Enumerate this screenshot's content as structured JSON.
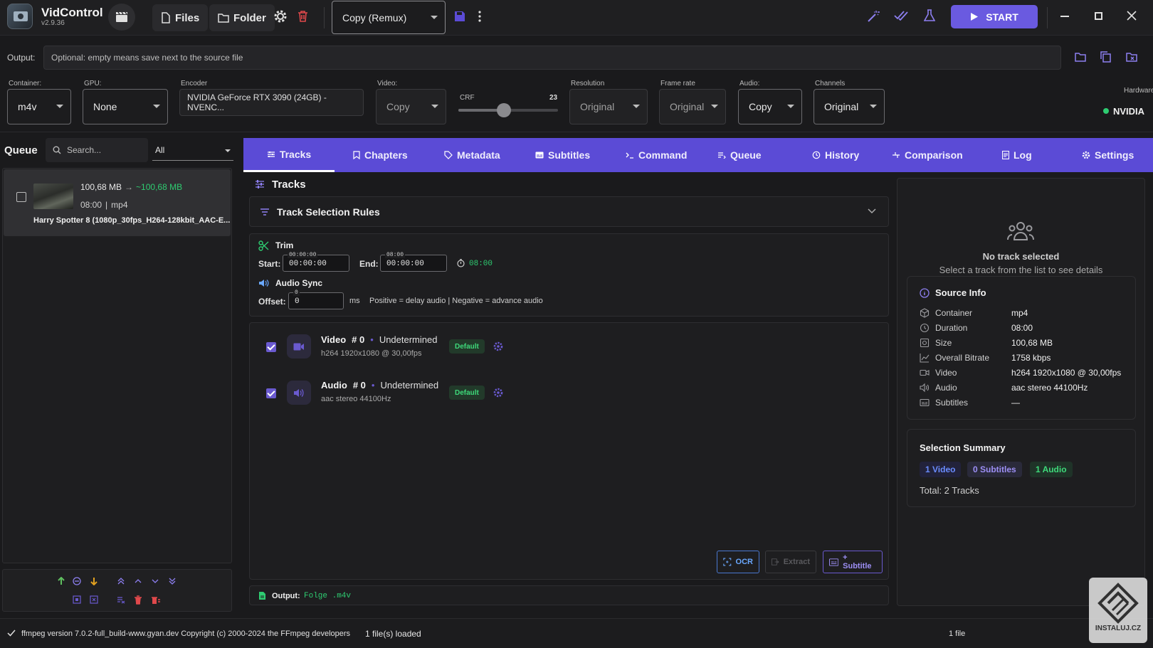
{
  "app": {
    "name": "VidControl",
    "version": "v2.9.36"
  },
  "toolbar": {
    "files_label": "Files",
    "folder_label": "Folder",
    "preset_value": "Copy (Remux)",
    "start_label": "START"
  },
  "output": {
    "label": "Output:",
    "placeholder": "Optional: empty means save next to the source file"
  },
  "settings": {
    "container_label": "Container:",
    "container_value": "m4v",
    "gpu_label": "GPU:",
    "gpu_value": "None",
    "encoder_label": "Encoder",
    "encoder_value": "NVIDIA GeForce RTX 3090 (24GB) - NVENC...",
    "video_label": "Video:",
    "video_value": "Copy",
    "crf_label": "CRF",
    "crf_value": "23",
    "crf_fraction": 0.46,
    "resolution_label": "Resolution",
    "resolution_value": "Original",
    "framerate_label": "Frame rate",
    "framerate_value": "Original",
    "audio_label": "Audio:",
    "audio_value": "Copy",
    "channels_label": "Channels",
    "channels_value": "Original",
    "hardware_label": "Hardware",
    "hardware_value": "NVIDIA",
    "hardware_color": "#2ecc71"
  },
  "queue": {
    "title": "Queue",
    "search_placeholder": "Search...",
    "filter_value": "All",
    "items": [
      {
        "size_from": "100,68 MB",
        "arrow": "→",
        "size_to": "~100,68 MB",
        "duration": "08:00",
        "sep": "|",
        "format": "mp4",
        "name": "Harry Spotter 8 (1080p_30fps_H264-128kbit_AAC-E..."
      }
    ]
  },
  "tabs": [
    {
      "label": "Tracks",
      "icon": "sliders-icon"
    },
    {
      "label": "Chapters",
      "icon": "bookmark-icon"
    },
    {
      "label": "Metadata",
      "icon": "tag-icon"
    },
    {
      "label": "Subtitles",
      "icon": "subtitles-icon"
    },
    {
      "label": "Command",
      "icon": "terminal-icon"
    },
    {
      "label": "Queue",
      "icon": "queue-icon"
    },
    {
      "label": "History",
      "icon": "history-icon"
    },
    {
      "label": "Comparison",
      "icon": "compare-icon"
    },
    {
      "label": "Log",
      "icon": "log-icon"
    },
    {
      "label": "Settings",
      "icon": "gear-icon"
    }
  ],
  "tracks": {
    "title": "Tracks",
    "rules_title": "Track Selection Rules",
    "trim": {
      "title": "Trim",
      "start_label": "Start:",
      "start_float": "00:00:00",
      "start_value": "00:00:00",
      "end_label": "End:",
      "end_float": "08:00",
      "end_value": "00:00:00",
      "duration": "08:00"
    },
    "audio_sync": {
      "title": "Audio Sync",
      "offset_label": "Offset:",
      "offset_float": "0",
      "offset_value": "0",
      "unit": "ms",
      "hint": "Positive = delay audio | Negative = advance audio"
    },
    "list": [
      {
        "type": "Video",
        "num": "# 0",
        "dot": "•",
        "lang": "Undetermined",
        "detail": "h264 1920x1080 @ 30,00fps",
        "badge": "Default"
      },
      {
        "type": "Audio",
        "num": "# 0",
        "dot": "•",
        "lang": "Undetermined",
        "detail": "aac stereo 44100Hz",
        "badge": "Default"
      }
    ],
    "ocr_label": "OCR",
    "extract_label": "Extract",
    "add_subtitle_label": "+ Subtitle",
    "output_label": "Output:",
    "output_value": "Folge .m4v"
  },
  "details": {
    "no_track_title": "No track selected",
    "no_track_hint": "Select a track from the list to see details",
    "source_title": "Source Info",
    "source": [
      {
        "key": "Container",
        "value": "mp4",
        "icon": "box-icon"
      },
      {
        "key": "Duration",
        "value": "08:00",
        "icon": "clock-icon"
      },
      {
        "key": "Size",
        "value": "100,68 MB",
        "icon": "disk-icon"
      },
      {
        "key": "Overall Bitrate",
        "value": "1758 kbps",
        "icon": "chart-icon"
      },
      {
        "key": "Video",
        "value": "h264 1920x1080 @ 30,00fps",
        "icon": "video-icon"
      },
      {
        "key": "Audio",
        "value": "aac stereo 44100Hz",
        "icon": "speaker-icon"
      },
      {
        "key": "Subtitles",
        "value": "—",
        "icon": "subtitles-icon"
      }
    ],
    "summary_title": "Selection Summary",
    "summary_video": "1 Video",
    "summary_subtitles": "0 Subtitles",
    "summary_audio": "1 Audio",
    "total": "Total: 2 Tracks"
  },
  "status": {
    "ffmpeg": "ffmpeg version 7.0.2-full_build-www.gyan.dev Copyright (c) 2000-2024 the FFmpeg developers",
    "loaded": "1 file(s) loaded",
    "count": "1 file"
  },
  "watermark": {
    "text": "INSTALUJ.CZ"
  },
  "colors": {
    "accent": "#5b4bd6",
    "green": "#2ecc71",
    "bg": "#1a1a1c"
  }
}
